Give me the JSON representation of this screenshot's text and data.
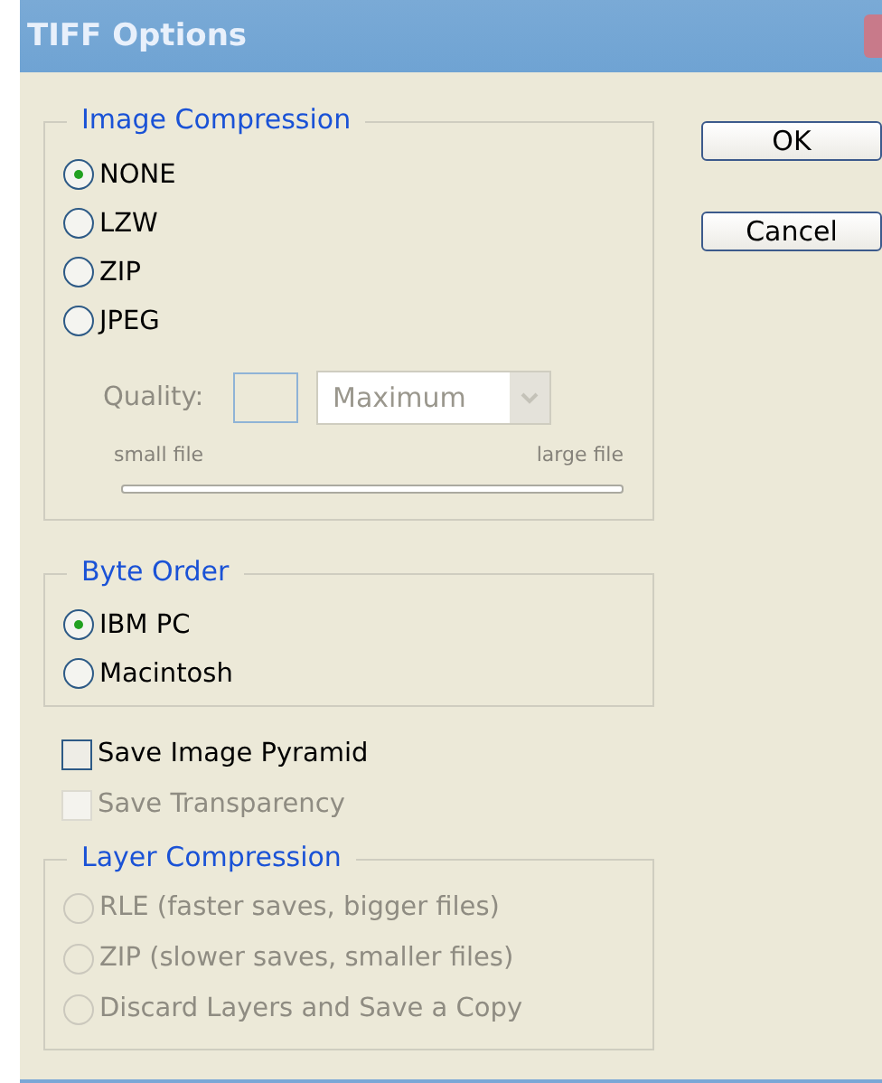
{
  "window": {
    "title": "TIFF Options"
  },
  "image_compression": {
    "title": "Image Compression",
    "options": [
      {
        "label": "NONE",
        "selected": true
      },
      {
        "label": "LZW",
        "selected": false
      },
      {
        "label": "ZIP",
        "selected": false
      },
      {
        "label": "JPEG",
        "selected": false
      }
    ],
    "quality": {
      "label": "Quality:",
      "disabled": true,
      "preset": "Maximum",
      "small_label": "small file",
      "large_label": "large file"
    }
  },
  "byte_order": {
    "title": "Byte Order",
    "options": [
      {
        "label": "IBM PC",
        "selected": true
      },
      {
        "label": "Macintosh",
        "selected": false
      }
    ]
  },
  "checkboxes": [
    {
      "label": "Save Image Pyramid",
      "checked": false,
      "disabled": false
    },
    {
      "label": "Save Transparency",
      "checked": false,
      "disabled": true
    }
  ],
  "layer_compression": {
    "title": "Layer Compression",
    "disabled": true,
    "options": [
      {
        "label": "RLE (faster saves, bigger files)",
        "selected": false
      },
      {
        "label": "ZIP (slower saves, smaller files)",
        "selected": false
      },
      {
        "label": "Discard Layers and Save a Copy",
        "selected": false
      }
    ]
  },
  "buttons": [
    "OK",
    "Cancel"
  ]
}
